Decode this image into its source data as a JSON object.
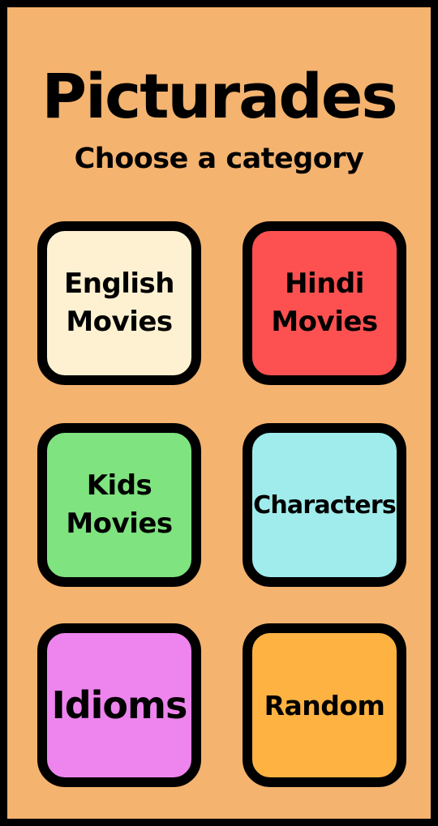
{
  "app": {
    "title": "Picturades",
    "subtitle": "Choose a category"
  },
  "categories": [
    {
      "id": "english-movies",
      "label": "English\nMovies",
      "color": "#fef1d1"
    },
    {
      "id": "hindi-movies",
      "label": "Hindi\nMovies",
      "color": "#fd5151"
    },
    {
      "id": "kids-movies",
      "label": "Kids\nMovies",
      "color": "#7fe37f"
    },
    {
      "id": "characters",
      "label": "Characters",
      "color": "#a0ecec"
    },
    {
      "id": "idioms",
      "label": "Idioms",
      "color": "#ee84ee"
    },
    {
      "id": "random",
      "label": "Random",
      "color": "#fdb242"
    }
  ],
  "theme": {
    "background": "#f4b36f",
    "border": "#000000"
  }
}
